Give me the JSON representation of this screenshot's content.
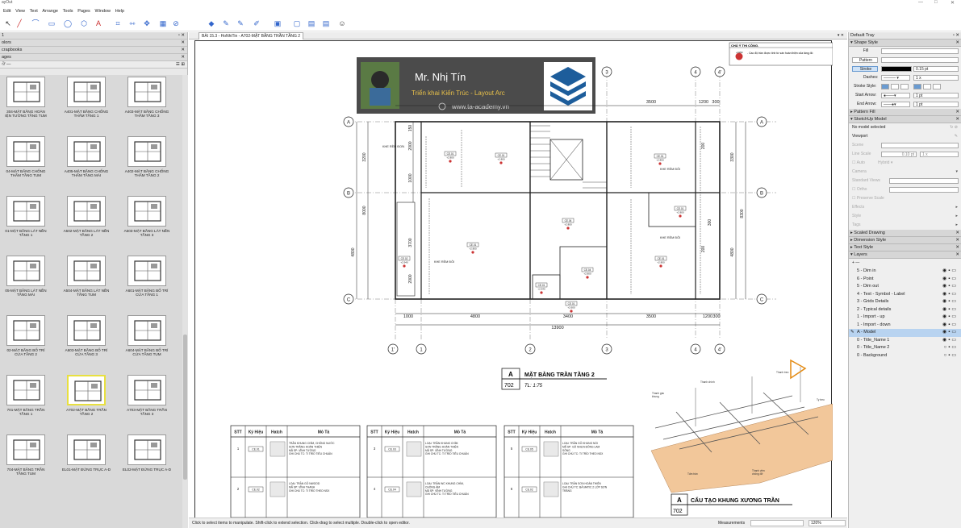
{
  "app": {
    "title": "ayOut",
    "win_min": "—",
    "win_max": "□",
    "win_close": "✕"
  },
  "menu": [
    "Edit",
    "View",
    "Text",
    "Arrange",
    "Tools",
    "Pages",
    "Window",
    "Help"
  ],
  "left": {
    "tray_label": "1",
    "tray_pin": "▫ ✕",
    "panels": [
      "olors",
      "crapbooks",
      "ages"
    ],
    "pages_controls": "ঔ  —",
    "view_icons": "☰ ⊞",
    "thumbs": [
      "304-MẶT BẰNG HOÀN\nIỆN TƯỜNG TẦNG TUM",
      "A401-MẶT BẰNG CHỐNG\nTHẤM TẦNG 1",
      "A403-MẶT BẰNG CHỐNG\nTHẤM TẦNG 3",
      "04-MẶT BẰNG CHỐNG\nTHẤM TẦNG TUM",
      "A405-MẶT BẰNG CHỐNG\nTHẤM TẦNG MÁI",
      "A402-MẶT BẰNG CHỐNG\nTHẤM TẦNG 2",
      "01-MẶT BẰNG LÁT NỀN\nTẦNG 1",
      "A502-MẶT BẰNG LÁT NỀN\nTẦNG 2",
      "A503-MẶT BẰNG LÁT NỀN\nTẦNG 3",
      "05-MẶT BẰNG LÁT NỀN\nTẦNG MÁI",
      "A504-MẶT BẰNG LÁT NỀN\nTẦNG TUM",
      "A601-MẶT BẰNG BỐ TRÍ\nCỬA TẦNG 1",
      "02-MẶT BẰNG BỐ TRÍ\nCỬA TẦNG 2",
      "A603-MẶT BẰNG BỐ TRÍ\nCỬA TẦNG 3",
      "A604-MẶT BẰNG BỐ TRÍ\nCỬA TẦNG TUM",
      "701-MẶT BẰNG TRẦN\nTẦNG 1",
      "A702-MẶT BẰNG TRẦN\nTẦNG 2",
      "A703-MẶT BẰNG TRẦN\nTẦNG 3",
      "704-MẶT BẰNG TRẦN\nTẦNG TUM",
      "EL01-MẶT ĐỨNG TRỤC A-D",
      "EL02-MẶT ĐỨNG TRỤC A-D"
    ]
  },
  "doc": {
    "tab": "BÀI 15.3 - HoNhiTin - A702-MẶT BẰNG TRẦN TẦNG 2",
    "close": "▾ ✕"
  },
  "banner": {
    "name": "Mr. Nhị Tín",
    "subtitle": "Triển khai Kiến Trúc - Layout Arc",
    "url": "www.ta-academy.vn"
  },
  "notes": {
    "title": "CHÚ Ý THI CÔNG.",
    "code": "+3150",
    "text": "- Cao độ trần được tính từ sàn hoàn thiện của tầng đó"
  },
  "plan": {
    "dims_top": [
      "3500",
      "1200",
      "300"
    ],
    "dims_bottom": [
      "1000",
      "4800",
      "3400",
      "3500",
      "1200",
      "300"
    ],
    "total": "13900",
    "left_dims": [
      "3200",
      "8000",
      "4800",
      "1000",
      "2000",
      "150",
      "3700",
      "2000"
    ],
    "right_dims": [
      "3300",
      "8300",
      "4800",
      "300",
      "200",
      "200"
    ],
    "axes_cols": [
      "1'",
      "1",
      "2",
      "3",
      "4",
      "4'"
    ],
    "axes_top": [
      "3",
      "4",
      "4'"
    ],
    "axes_rows": [
      "A",
      "B",
      "C"
    ],
    "labels": [
      "KHE RÈM ĐƠN",
      "KHE RÈM ĐÔI",
      "KHE RÈM ĐÔI",
      "KHE RÈM ĐÔI",
      "KHE RÈM ĐÔI"
    ],
    "tags": [
      "CE.01",
      "CE.01",
      "CE.01",
      "CE.01",
      "CE.04",
      "CE.01",
      "CE.02",
      "CE.04",
      "CE.01",
      "CE.01",
      "CE.01"
    ],
    "hts": [
      "+2.800",
      "+2.800",
      "+2.800",
      "+2.800",
      "+2.800",
      "+2.800",
      "+2.940",
      "+2.800",
      "+2.800",
      "+2.940",
      "+2.600"
    ]
  },
  "title1": {
    "letter": "A",
    "num": "702",
    "name": "MẶT BẰNG TRẦN TẦNG 2",
    "scale": "TL: 1:75"
  },
  "title2": {
    "letter": "A",
    "num": "702",
    "name": "CẤU TẠO KHUNG XƯƠNG TRẦN"
  },
  "iso_labels": [
    "Thanh gác\nkhung",
    "Thanh chính",
    "Thanh treo",
    "Tấm trần",
    "Thanh viền\nchống đỡ",
    "Ty treo"
  ],
  "tables": [
    {
      "head": [
        "STT",
        "Ký Hiệu",
        "Hatch",
        "Mô Tả"
      ],
      "rows": [
        [
          "1",
          "CE.01",
          "TRẦN KHUNG CHÌM, CHỐNG NƯỚC\nSƠN TRẮNG HOÀN THIỆN\nMÃ SP: VĨNH TƯỜNG\nGHI CHÚ TC: TI TRÍO TIÊU CHUẨN"
        ],
        [
          "2",
          "CE.02",
          "LOẠI: TRẦN GỖ NWOOD\nMÃ SP: VĨNH THANH\nGHI CHÚ TC: TI TRÍO THEO NSX"
        ]
      ]
    },
    {
      "head": [
        "STT",
        "Ký Hiệu",
        "Hatch",
        "Mô Tả"
      ],
      "rows": [
        [
          "3",
          "CE.03",
          "LOẠI: TRẦN KHUNG CHÌM\nSƠN TRẮNG HOÀN THIỆN\nMÃ SP: VĨNH TƯỜNG\nGHI CHÚ TC: TI TRÍO TIÊU CHUẨN"
        ],
        [
          "4",
          "CE.04",
          "LOẠI: TRẦN WC KHUNG CHÌM,\nCHỐNG ẨM\nMÃ SP: VĨNH TƯỜNG\nGHI CHÚ TC: TI TRÍO TIÊU CHUẨN"
        ]
      ]
    },
    {
      "head": [
        "STT",
        "Ký Hiệu",
        "Hatch",
        "Mô Tả"
      ],
      "rows": [
        [
          "5",
          "CE.05",
          "LOẠI: TRẦN GỖ KHUNG NỔI\nMÃ SP: GỖ NHỰA ĐÔNG LAM\nSÔNG\nGHI CHÚ TC: TI TRÍO THEO NSX"
        ],
        [
          "6",
          "CE.02",
          "LOẠI: TRẦN SƠN HOÀN THIỆN\nGHI CHÚ TC: BẢ MATIC 2 LỚP SƠN\nTRẮNG"
        ]
      ]
    }
  ],
  "status": {
    "hint": "Click to select items to manipulate. Shift-click to extend selection. Click-drag to select multiple. Double-click to open editor.",
    "measure_label": "Measurements",
    "zoom": "120%"
  },
  "right": {
    "tray_title": "Default Tray",
    "shape_style": "Shape Style",
    "fill": "Fill",
    "pattern": "Pattern",
    "stroke": "Stroke",
    "stroke_val": "0.15 pt",
    "dashes": "Dashes:",
    "dash_val": "1 x",
    "stroke_style": "Stroke Style:",
    "start_arrow": "Start Arrow:",
    "start_val": "1 pt",
    "end_arrow": "End Arrow:",
    "end_val": "1 pt",
    "pattern_fill": "Pattern Fill",
    "sketchup": "SketchUp Model",
    "no_model": "No model selected",
    "viewport": "Viewport",
    "scene": "Scene",
    "line_scale": "Line Scale",
    "ls_val": "0.10 pt",
    "ls_x": "1 x",
    "auto": "Auto",
    "hybrid": "Hybrid",
    "camera": "Camera",
    "std_views": "Standard Views",
    "ortho": "Ortho",
    "preserve": "Preserve Scale",
    "effects": "Effects",
    "style": "Style",
    "tags": "Tags",
    "scaled": "Scaled Drawing",
    "dim_style": "Dimension Style",
    "text_style": "Text Style",
    "layers": "Layers",
    "layer_ctrl": "+ —",
    "layer_list": [
      "5 - Dim in",
      "6 - Point",
      "5 - Dim out",
      "4 - Text - Symbol - Label",
      "3 - Grids Details",
      "2 - Typical details",
      "1 - Import - up",
      "1 - Import - down",
      "A - Model",
      "0 - Title_Name 1",
      "0 - Title_Name 2",
      "0 - Background"
    ]
  },
  "colors": {
    "accent": "#b8d3f0",
    "thumb_sel": "#e8e040",
    "banner": "#3c3c3c",
    "logo": "#1d5d9b"
  }
}
